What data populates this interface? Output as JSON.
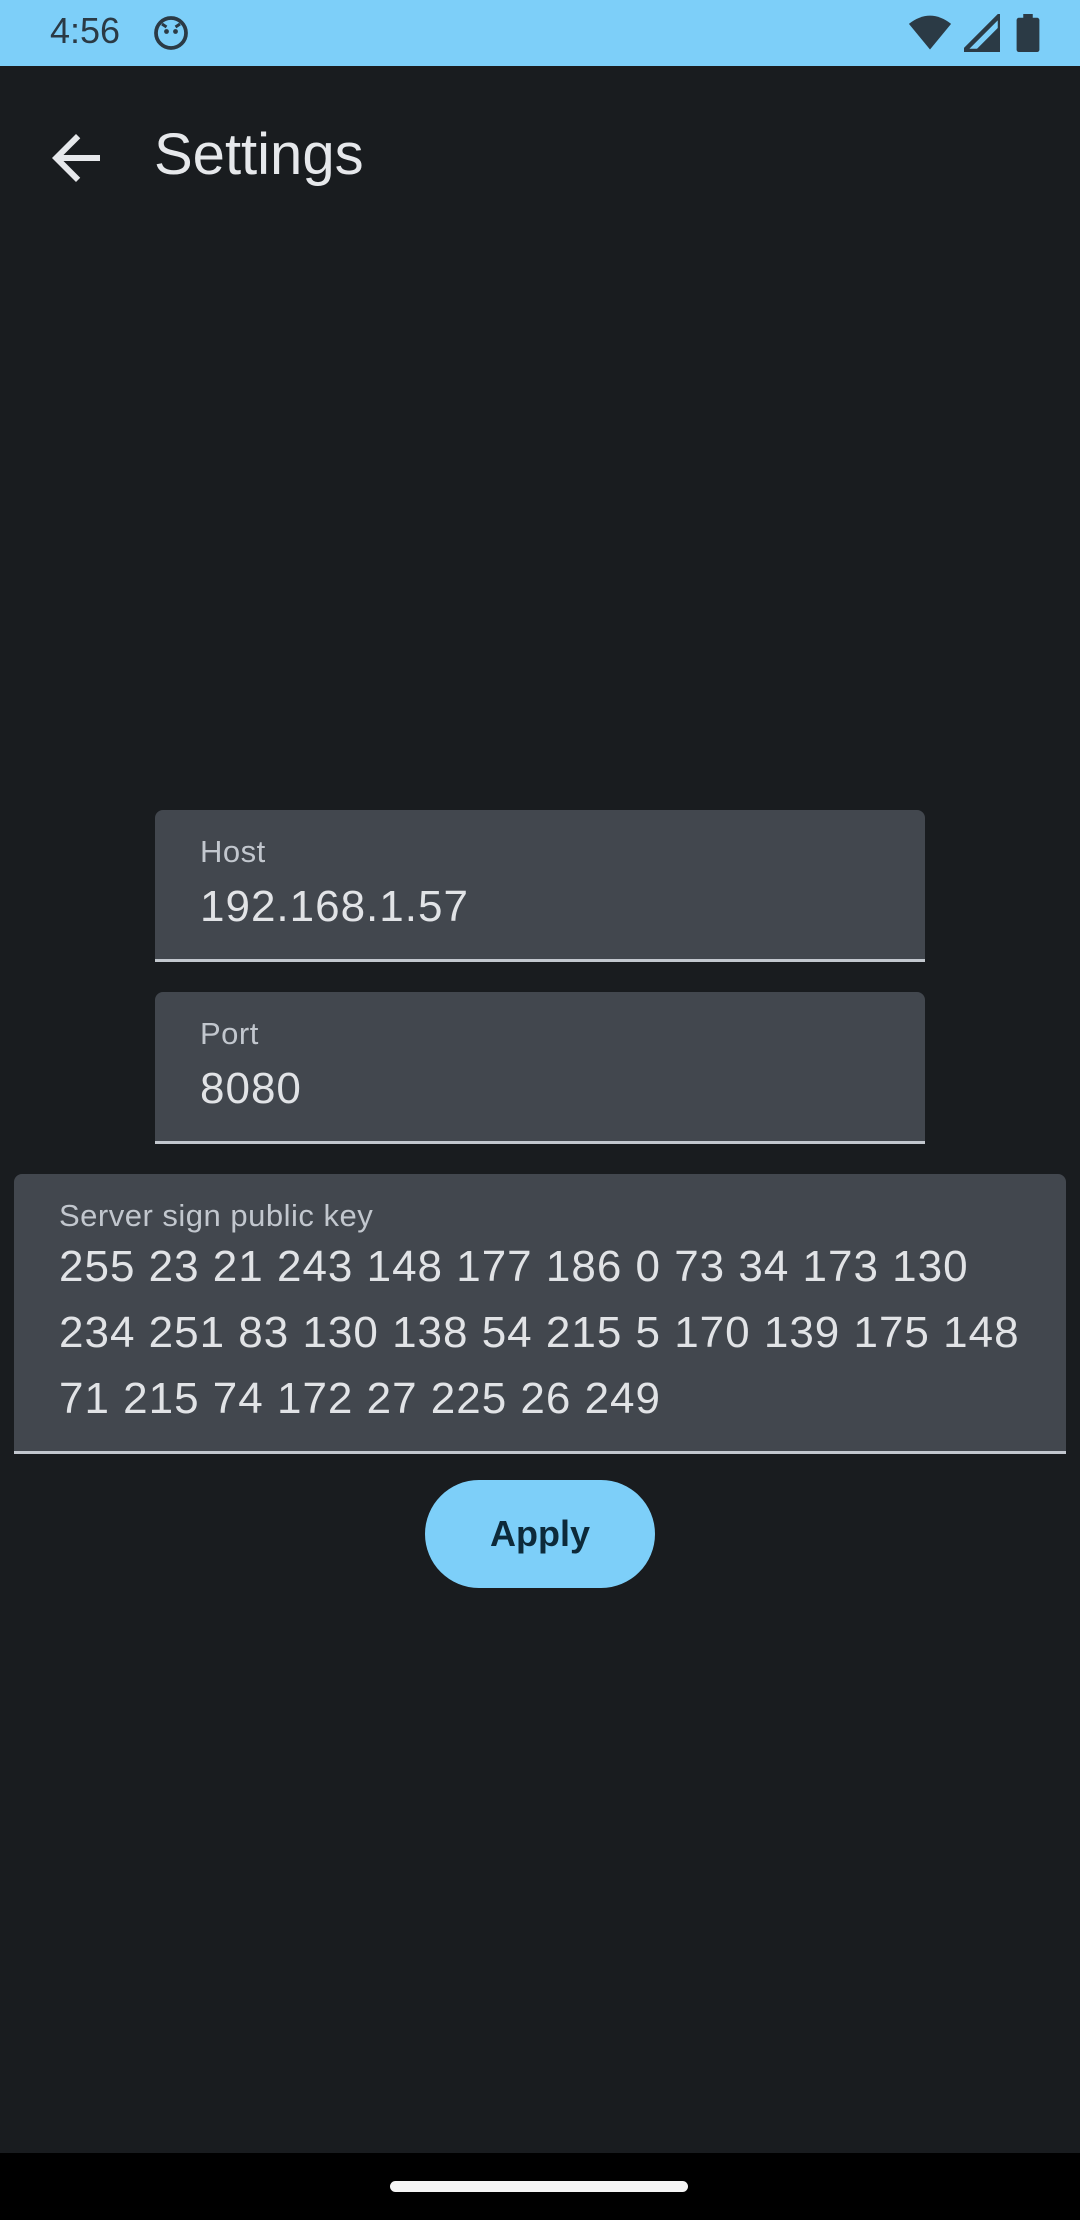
{
  "status_bar": {
    "time": "4:56",
    "icons": [
      "app-notification-icon",
      "wifi-icon",
      "signal-icon",
      "battery-icon"
    ]
  },
  "app_bar": {
    "title": "Settings",
    "back_icon": "arrow-back-icon"
  },
  "form": {
    "host": {
      "label": "Host",
      "value": "192.168.1.57"
    },
    "port": {
      "label": "Port",
      "value": "8080"
    },
    "server_key": {
      "label": "Server sign public key",
      "value": "255 23 21 243 148 177 186 0 73 34 173 130 234 251 83 130 138 54 215 5 170 139 175 148 71 215 74 172 27 225 26 249"
    },
    "apply_label": "Apply"
  },
  "colors": {
    "accent": "#7dcff9",
    "background": "#191c1f",
    "field_bg": "#42474e",
    "text_primary": "#e1e3e6",
    "text_secondary": "#c2c7ce"
  }
}
